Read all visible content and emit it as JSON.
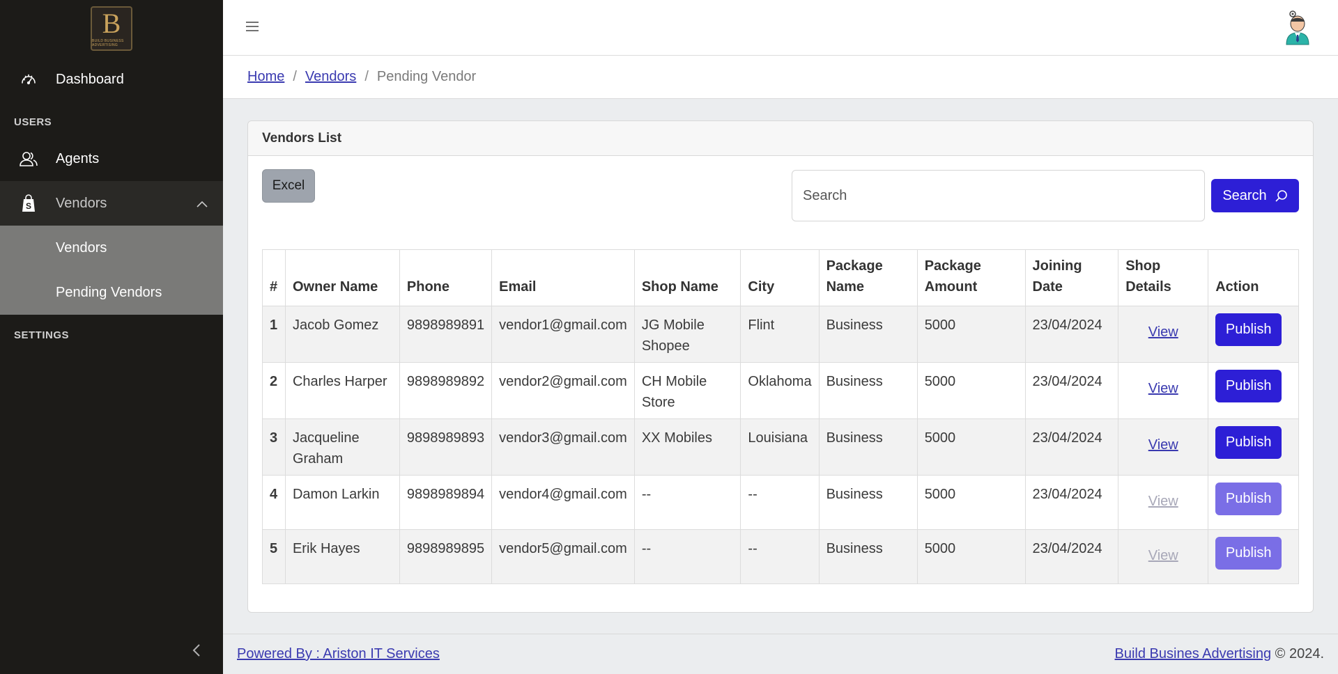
{
  "brand": {
    "logo_letter": "B",
    "logo_text": "BUILD BUSINESS ADVERTISING"
  },
  "sidebar": {
    "dashboard": "Dashboard",
    "section_users": "USERS",
    "agents": "Agents",
    "vendors": "Vendors",
    "sub_vendors": "Vendors",
    "sub_pending": "Pending Vendors",
    "section_settings": "SETTINGS"
  },
  "breadcrumb": {
    "home": "Home",
    "vendors": "Vendors",
    "current": "Pending Vendor"
  },
  "card": {
    "title": "Vendors List",
    "excel": "Excel",
    "search_placeholder": "Search",
    "search_button": "Search"
  },
  "table": {
    "headers": [
      "#",
      "Owner Name",
      "Phone",
      "Email",
      "Shop Name",
      "City",
      "Package Name",
      "Package Amount",
      "Joining Date",
      "Shop Details",
      "Action"
    ],
    "rows": [
      {
        "num": "1",
        "owner": "Jacob Gomez",
        "phone": "9898989891",
        "email": "vendor1@gmail.com",
        "shop": "JG Mobile Shopee",
        "city": "Flint",
        "package": "Business",
        "amount": "5000",
        "date": "23/04/2024",
        "details": "View",
        "action": "Publish"
      },
      {
        "num": "2",
        "owner": "Charles Harper",
        "phone": "9898989892",
        "email": "vendor2@gmail.com",
        "shop": "CH Mobile Store",
        "city": "Oklahoma",
        "package": "Business",
        "amount": "5000",
        "date": "23/04/2024",
        "details": "View",
        "action": "Publish"
      },
      {
        "num": "3",
        "owner": "Jacqueline Graham",
        "phone": "9898989893",
        "email": "vendor3@gmail.com",
        "shop": "XX Mobiles",
        "city": "Louisiana",
        "package": "Business",
        "amount": "5000",
        "date": "23/04/2024",
        "details": "View",
        "action": "Publish"
      },
      {
        "num": "4",
        "owner": "Damon Larkin",
        "phone": "9898989894",
        "email": "vendor4@gmail.com",
        "shop": "--",
        "city": "--",
        "package": "Business",
        "amount": "5000",
        "date": "23/04/2024",
        "details": "View",
        "action": "Publish"
      },
      {
        "num": "5",
        "owner": "Erik Hayes",
        "phone": "9898989895",
        "email": "vendor5@gmail.com",
        "shop": "--",
        "city": "--",
        "package": "Business",
        "amount": "5000",
        "date": "23/04/2024",
        "details": "View",
        "action": "Publish"
      }
    ]
  },
  "footer": {
    "powered": "Powered By : Ariston IT Services",
    "brand_link": "Build Busines Advertising",
    "copyright": "© 2024."
  },
  "colors": {
    "sidebar_bg": "#1c1b18",
    "primary": "#2d1fd6",
    "primary_disabled": "#7a6ee6",
    "link": "#3a3ab0"
  }
}
